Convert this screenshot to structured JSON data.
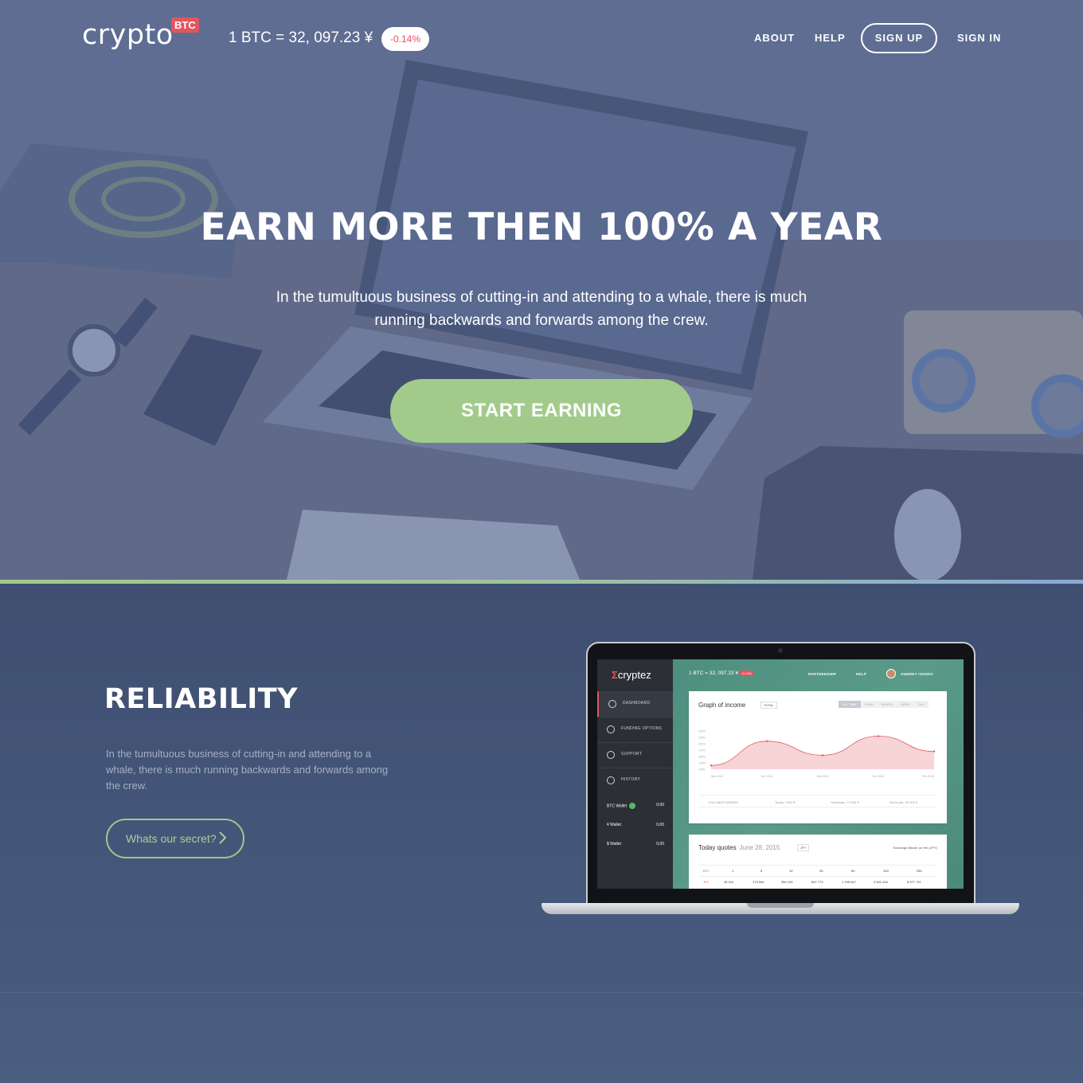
{
  "header": {
    "logo_text": "crypto",
    "logo_badge": "BTC",
    "rate": "1 BTC = 32, 097.23 ¥",
    "rate_change": "-0.14%",
    "nav": {
      "about": "ABOUT",
      "help": "HELP",
      "signup": "SIGN UP",
      "signin": "SIGN IN"
    }
  },
  "hero": {
    "title": "EARN MORE THEN 100% A YEAR",
    "subtitle": "In the tumultuous business of cutting-in and attending to a whale, there is much running backwards and forwards among the crew.",
    "cta": "START EARNING"
  },
  "reliability": {
    "title": "RELIABILITY",
    "text": "In the tumultuous business of cutting-in and attending to a whale, there is much running backwards and forwards among the crew.",
    "button": "Whats our secret?"
  },
  "mockup": {
    "logo": "cryptez",
    "rate": "1 BTC = 32, 097.23 ¥",
    "rate_badge": "-0.14%",
    "nav": {
      "partnership": "PARTNERSHIP",
      "help": "HELP",
      "user": "ANDREY IVANOV"
    },
    "menu": [
      "DASHBOARD",
      "FUNDING OPTIONS",
      "SUPPORT",
      "HISTORY"
    ],
    "wallets": [
      {
        "label": "BTC Wallet",
        "value": "0,00"
      },
      {
        "label": "¥ Wallet",
        "value": "0,00"
      },
      {
        "label": "$ Wallet",
        "value": "0,00"
      }
    ],
    "graph": {
      "title": "Graph of income",
      "select": "TOTAL",
      "tabs": [
        "ALL TIME",
        "YEAR",
        "MONTH",
        "WEEK",
        "DAY"
      ],
      "earned_label": "YOU HAVE EARNED",
      "today": "Today: +400 ¥",
      "yesterday": "Yesterday: +1 000 ¥",
      "since": "Since join: 30 000 ¥"
    },
    "quotes": {
      "title": "Today quotes",
      "date": "June 28, 2015",
      "select": "JPY",
      "exchange": "Exchange Bitcoin on Yen (JPY)",
      "header": [
        "BTC",
        "1",
        "5",
        "10",
        "25",
        "50",
        "100",
        "250"
      ],
      "row": [
        "JPY",
        "35 910",
        "179 554",
        "359 109",
        "897 773",
        "1 795 547",
        "3 591 094",
        "8 977 737"
      ]
    }
  },
  "chart_data": {
    "type": "area",
    "x": [
      "Mar 2015",
      "Jun 2015",
      "Sep 2015",
      "Dec 2015",
      "Feb 2016"
    ],
    "yticks": [
      "100%",
      "125%",
      "150%",
      "175%",
      "200%",
      "225%",
      "250%"
    ],
    "series": [
      {
        "values": [
          115,
          210,
          155,
          230,
          170
        ]
      }
    ],
    "colors": {
      "line": "#e3555f",
      "fill": "#f7d4d6"
    }
  }
}
